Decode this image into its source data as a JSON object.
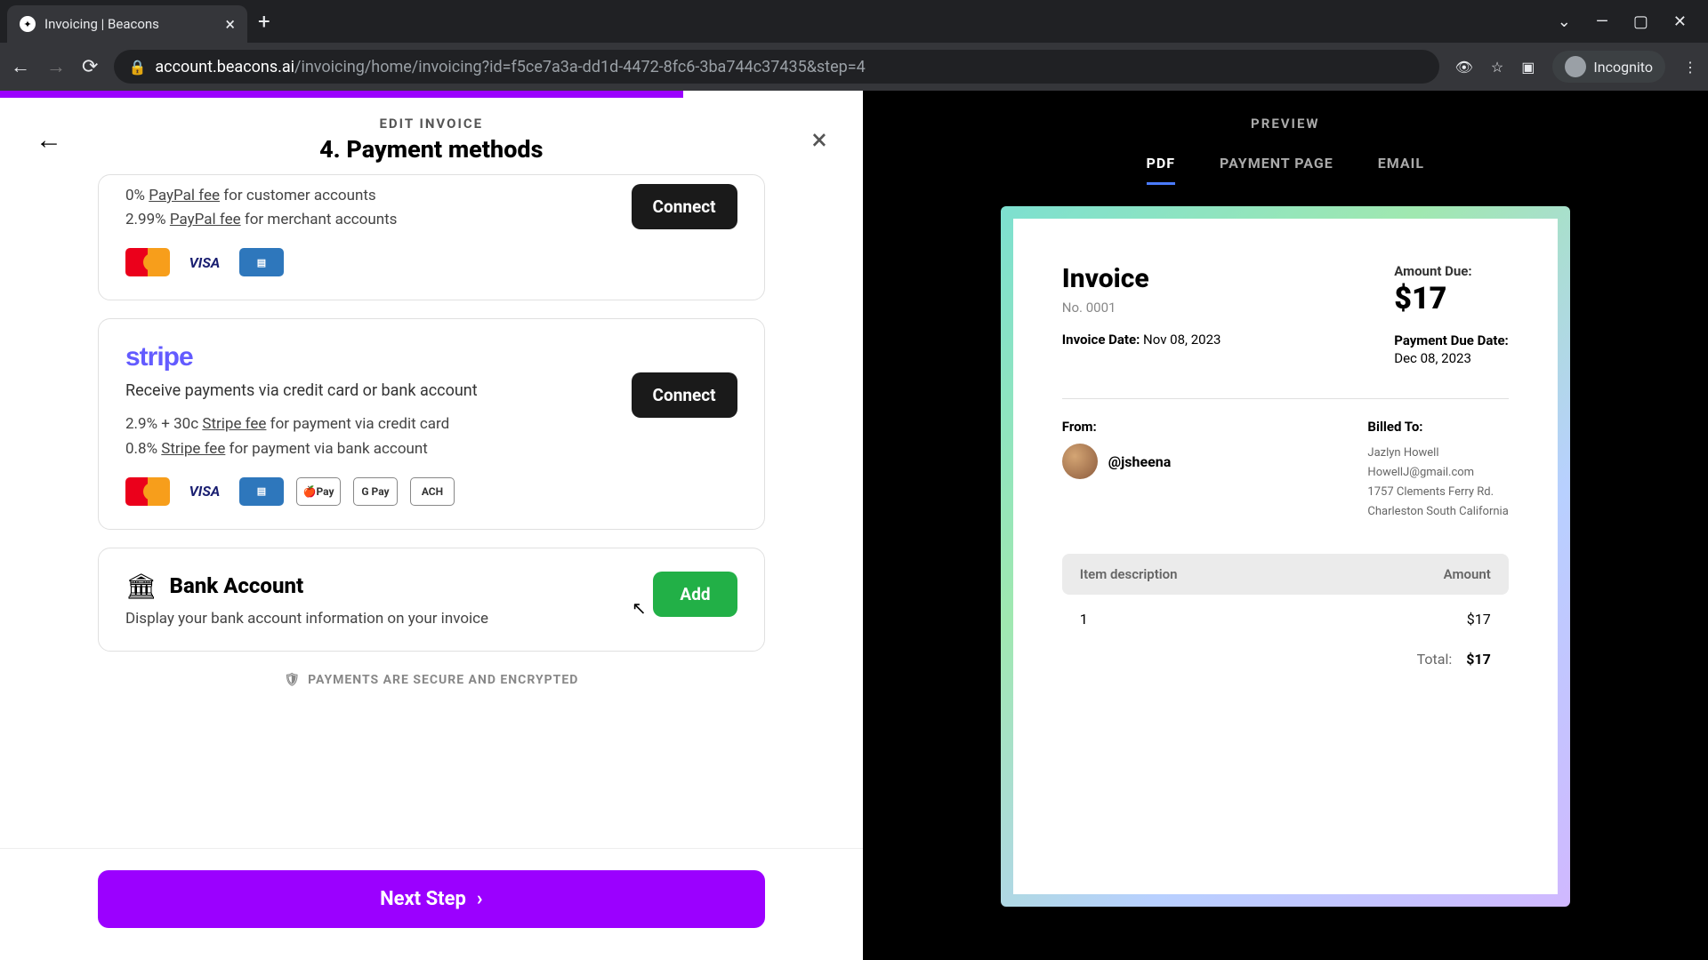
{
  "browser": {
    "tab_title": "Invoicing | Beacons",
    "url_domain": "account.beacons.ai",
    "url_path": "/invoicing/home/invoicing?id=f5ce7a3a-dd1d-4472-8fc6-3ba744c37435&step=4",
    "incognito": "Incognito"
  },
  "header": {
    "edit_label": "EDIT INVOICE",
    "step_title": "4. Payment methods"
  },
  "paypal": {
    "fee1_prefix": "0% ",
    "fee1_link": "PayPal fee",
    "fee1_suffix": " for customer accounts",
    "fee2_prefix": "2.99% ",
    "fee2_link": "PayPal fee",
    "fee2_suffix": " for merchant accounts",
    "connect": "Connect"
  },
  "stripe": {
    "logo": "stripe",
    "desc": "Receive payments via credit card or bank account",
    "fee1_prefix": "2.9% + 30c ",
    "fee1_link": "Stripe fee",
    "fee1_suffix": " for payment via credit card",
    "fee2_prefix": "0.8% ",
    "fee2_link": "Stripe fee",
    "fee2_suffix": " for payment via bank account",
    "connect": "Connect",
    "apay": "🍎Pay",
    "gpay": "G Pay",
    "ach": "ACH"
  },
  "bank": {
    "title": "Bank Account",
    "desc": "Display your bank account information on your invoice",
    "add": "Add"
  },
  "secure": "PAYMENTS ARE SECURE AND ENCRYPTED",
  "next": "Next Step",
  "preview": {
    "label": "PREVIEW",
    "tabs": {
      "pdf": "PDF",
      "payment": "PAYMENT PAGE",
      "email": "EMAIL"
    }
  },
  "invoice": {
    "title": "Invoice",
    "no": "No. 0001",
    "date_label": "Invoice Date:",
    "date_value": " Nov 08, 2023",
    "amount_label": "Amount Due:",
    "amount_value": "$17",
    "due_label": "Payment Due Date:",
    "due_value": "Dec 08, 2023",
    "from_label": "From:",
    "from_handle": "@jsheena",
    "billed_label": "Billed To:",
    "billed_name": "Jazlyn Howell",
    "billed_email": "HowellJ@gmail.com",
    "billed_addr1": "1757 Clements Ferry Rd.",
    "billed_addr2": "Charleston South California",
    "col_desc": "Item description",
    "col_amt": "Amount",
    "row_desc": "1",
    "row_amt": "$17",
    "total_label": "Total:",
    "total_value": "$17"
  }
}
